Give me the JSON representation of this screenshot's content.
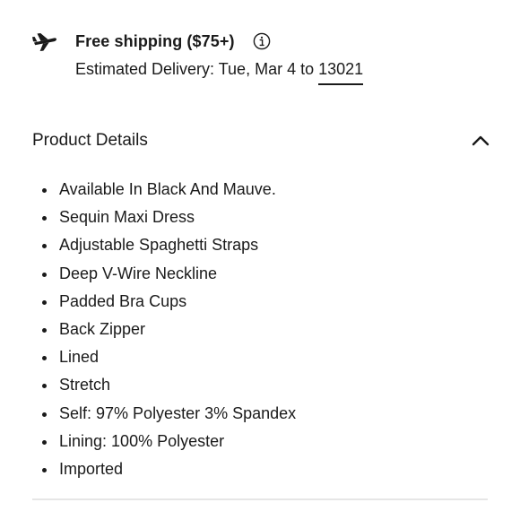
{
  "shipping": {
    "icon": "airplane-icon",
    "title": "Free shipping ($75+)",
    "info_icon": "info-icon",
    "delivery_prefix": "Estimated Delivery: Tue, Mar 4 to ",
    "zip_code": "13021"
  },
  "product_details": {
    "title": "Product Details",
    "toggle_icon": "chevron-up-icon",
    "expanded": true,
    "items": [
      "Available In Black And Mauve.",
      "Sequin Maxi Dress",
      "Adjustable Spaghetti Straps",
      "Deep V-Wire Neckline",
      "Padded Bra Cups",
      "Back Zipper",
      "Lined",
      "Stretch",
      "Self: 97% Polyester 3% Spandex",
      "Lining: 100% Polyester",
      "Imported"
    ]
  },
  "colors": {
    "text": "#1a1a1a",
    "divider": "#e6e6e6",
    "background": "#ffffff"
  }
}
